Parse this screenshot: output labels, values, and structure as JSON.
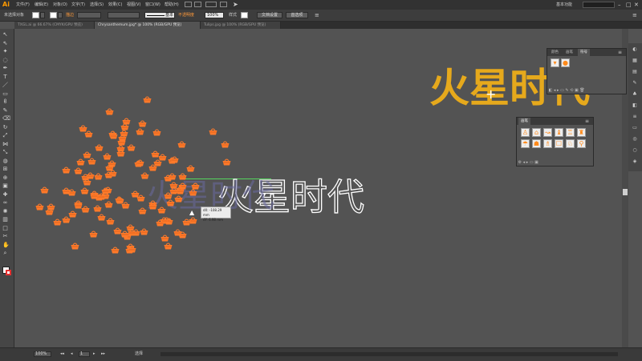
{
  "app": {
    "logo": "Ai"
  },
  "menu": {
    "items": [
      "文件(F)",
      "编辑(E)",
      "对象(O)",
      "文字(T)",
      "选择(S)",
      "效果(C)",
      "视图(V)",
      "窗口(W)",
      "帮助(H)"
    ]
  },
  "workspace": {
    "label": "基本功能"
  },
  "control_bar": {
    "selection_label": "未选择对象",
    "stroke_label": "描边",
    "stroke_style": "基本",
    "opacity_label": "不透明度",
    "opacity_value": "100%",
    "style_label": "样式",
    "doc_setup_button": "文档设置",
    "prefs_button": "首选项"
  },
  "tabs": [
    {
      "label": "TXGL.ai @ 66.67% (CMYK/GPU 预览)",
      "active": false
    },
    {
      "label": "Chrysanthemum.jpg* @ 100% (RGB/GPU 预览)",
      "active": true
    },
    {
      "label": "Tulips.jpg @ 100% (RGB/GPU 预览)",
      "active": false
    }
  ],
  "canvas": {
    "outline_text": "火星时代",
    "gold_text": "火星时代",
    "basket_color": "#ff7a2a",
    "gold_color": "#e6a91c",
    "guide_color": "#54d65e",
    "hud_dx": "dX: -108.29 mm",
    "hud_dy": "dY: 6.98 mm"
  },
  "symbols_panel": {
    "tabs": [
      "颜色",
      "画笔",
      "符号"
    ],
    "active_tab": "符号"
  },
  "brushes_panel": {
    "title": "画笔"
  },
  "status_bar": {
    "zoom": "100%",
    "page": "1",
    "tool": "选择"
  },
  "icons": [
    "selection-tool-icon",
    "direct-selection-tool-icon",
    "magic-wand-icon",
    "lasso-icon",
    "pen-tool-icon",
    "type-tool-icon",
    "line-tool-icon",
    "rectangle-tool-icon",
    "paintbrush-icon",
    "pencil-icon",
    "eraser-icon",
    "rotate-icon",
    "scale-icon",
    "width-tool-icon",
    "free-transform-icon",
    "shape-builder-icon",
    "perspective-grid-icon",
    "mesh-icon",
    "gradient-icon",
    "eyedropper-icon",
    "blend-icon",
    "symbol-sprayer-icon",
    "graph-icon",
    "artboard-icon",
    "slice-icon",
    "hand-icon",
    "zoom-icon"
  ]
}
